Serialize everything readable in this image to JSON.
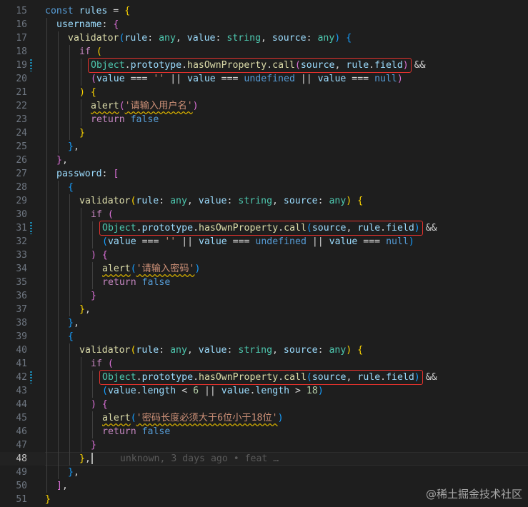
{
  "editor": {
    "active_line": 48,
    "lines": [
      {
        "n": 15,
        "indent": 0,
        "tokens": [
          [
            "kw",
            "const"
          ],
          [
            "t",
            " "
          ],
          [
            "prop",
            "rules"
          ],
          [
            "op",
            " = "
          ],
          [
            "p1",
            "{"
          ]
        ]
      },
      {
        "n": 16,
        "indent": 1,
        "tokens": [
          [
            "prop",
            "username"
          ],
          [
            "op",
            ": "
          ],
          [
            "p2",
            "{"
          ]
        ]
      },
      {
        "n": 17,
        "indent": 2,
        "tokens": [
          [
            "fn",
            "validator"
          ],
          [
            "p3",
            "("
          ],
          [
            "prop",
            "rule"
          ],
          [
            "op",
            ": "
          ],
          [
            "ty",
            "any"
          ],
          [
            "op",
            ", "
          ],
          [
            "prop",
            "value"
          ],
          [
            "op",
            ": "
          ],
          [
            "ty",
            "string"
          ],
          [
            "op",
            ", "
          ],
          [
            "prop",
            "source"
          ],
          [
            "op",
            ": "
          ],
          [
            "ty",
            "any"
          ],
          [
            "p3",
            ")"
          ],
          [
            "t",
            " "
          ],
          [
            "p3",
            "{"
          ]
        ]
      },
      {
        "n": 18,
        "indent": 3,
        "tokens": [
          [
            "ctrl",
            "if"
          ],
          [
            "t",
            " "
          ],
          [
            "p1",
            "("
          ]
        ]
      },
      {
        "n": 19,
        "indent": 4,
        "marker": true,
        "box": true,
        "tokens": [
          [
            "cls",
            "Object"
          ],
          [
            "op",
            "."
          ],
          [
            "prop",
            "prototype"
          ],
          [
            "op",
            "."
          ],
          [
            "fn",
            "hasOwnProperty"
          ],
          [
            "op",
            "."
          ],
          [
            "fn",
            "call"
          ],
          [
            "p2",
            "("
          ],
          [
            "prop",
            "source"
          ],
          [
            "op",
            ", "
          ],
          [
            "prop",
            "rule"
          ],
          [
            "op",
            "."
          ],
          [
            "prop",
            "field"
          ],
          [
            "p2",
            ")"
          ],
          [
            "op",
            " &&"
          ]
        ]
      },
      {
        "n": 20,
        "indent": 4,
        "tokens": [
          [
            "p2",
            "("
          ],
          [
            "prop",
            "value"
          ],
          [
            "op",
            " === "
          ],
          [
            "str",
            "''"
          ],
          [
            "op",
            " || "
          ],
          [
            "prop",
            "value"
          ],
          [
            "op",
            " === "
          ],
          [
            "kw",
            "undefined"
          ],
          [
            "op",
            " || "
          ],
          [
            "prop",
            "value"
          ],
          [
            "op",
            " === "
          ],
          [
            "kw",
            "null"
          ],
          [
            "p2",
            ")"
          ]
        ]
      },
      {
        "n": 21,
        "indent": 3,
        "tokens": [
          [
            "p1",
            ")"
          ],
          [
            "t",
            " "
          ],
          [
            "p1",
            "{"
          ]
        ]
      },
      {
        "n": 22,
        "indent": 4,
        "tokens": [
          [
            "fn warn",
            "alert"
          ],
          [
            "p2",
            "("
          ],
          [
            "str warn",
            "'请输入用户名'"
          ],
          [
            "p2",
            ")"
          ]
        ]
      },
      {
        "n": 23,
        "indent": 4,
        "tokens": [
          [
            "ctrl",
            "return"
          ],
          [
            "t",
            " "
          ],
          [
            "kw",
            "false"
          ]
        ]
      },
      {
        "n": 24,
        "indent": 3,
        "tokens": [
          [
            "p1",
            "}"
          ]
        ]
      },
      {
        "n": 25,
        "indent": 2,
        "tokens": [
          [
            "p3",
            "}"
          ],
          [
            "op",
            ","
          ]
        ]
      },
      {
        "n": 26,
        "indent": 1,
        "tokens": [
          [
            "p2",
            "}"
          ],
          [
            "op",
            ","
          ]
        ]
      },
      {
        "n": 27,
        "indent": 1,
        "tokens": [
          [
            "prop",
            "password"
          ],
          [
            "op",
            ": "
          ],
          [
            "p2",
            "["
          ]
        ]
      },
      {
        "n": 28,
        "indent": 2,
        "tokens": [
          [
            "p3",
            "{"
          ]
        ]
      },
      {
        "n": 29,
        "indent": 3,
        "tokens": [
          [
            "fn",
            "validator"
          ],
          [
            "p1",
            "("
          ],
          [
            "prop",
            "rule"
          ],
          [
            "op",
            ": "
          ],
          [
            "ty",
            "any"
          ],
          [
            "op",
            ", "
          ],
          [
            "prop",
            "value"
          ],
          [
            "op",
            ": "
          ],
          [
            "ty",
            "string"
          ],
          [
            "op",
            ", "
          ],
          [
            "prop",
            "source"
          ],
          [
            "op",
            ": "
          ],
          [
            "ty",
            "any"
          ],
          [
            "p1",
            ")"
          ],
          [
            "t",
            " "
          ],
          [
            "p1",
            "{"
          ]
        ]
      },
      {
        "n": 30,
        "indent": 4,
        "tokens": [
          [
            "ctrl",
            "if"
          ],
          [
            "t",
            " "
          ],
          [
            "p2",
            "("
          ]
        ]
      },
      {
        "n": 31,
        "indent": 5,
        "marker": true,
        "box": true,
        "tokens": [
          [
            "cls",
            "Object"
          ],
          [
            "op",
            "."
          ],
          [
            "prop",
            "prototype"
          ],
          [
            "op",
            "."
          ],
          [
            "fn",
            "hasOwnProperty"
          ],
          [
            "op",
            "."
          ],
          [
            "fn",
            "call"
          ],
          [
            "p3",
            "("
          ],
          [
            "prop",
            "source"
          ],
          [
            "op",
            ", "
          ],
          [
            "prop",
            "rule"
          ],
          [
            "op",
            "."
          ],
          [
            "prop",
            "field"
          ],
          [
            "p3",
            ")"
          ],
          [
            "op",
            " &&"
          ]
        ]
      },
      {
        "n": 32,
        "indent": 5,
        "tokens": [
          [
            "p3",
            "("
          ],
          [
            "prop",
            "value"
          ],
          [
            "op",
            " === "
          ],
          [
            "str",
            "''"
          ],
          [
            "op",
            " || "
          ],
          [
            "prop",
            "value"
          ],
          [
            "op",
            " === "
          ],
          [
            "kw",
            "undefined"
          ],
          [
            "op",
            " || "
          ],
          [
            "prop",
            "value"
          ],
          [
            "op",
            " === "
          ],
          [
            "kw",
            "null"
          ],
          [
            "p3",
            ")"
          ]
        ]
      },
      {
        "n": 33,
        "indent": 4,
        "tokens": [
          [
            "p2",
            ")"
          ],
          [
            "t",
            " "
          ],
          [
            "p2",
            "{"
          ]
        ]
      },
      {
        "n": 34,
        "indent": 5,
        "tokens": [
          [
            "fn warn",
            "alert"
          ],
          [
            "p3",
            "("
          ],
          [
            "str warn",
            "'请输入密码'"
          ],
          [
            "p3",
            ")"
          ]
        ]
      },
      {
        "n": 35,
        "indent": 5,
        "tokens": [
          [
            "ctrl",
            "return"
          ],
          [
            "t",
            " "
          ],
          [
            "kw",
            "false"
          ]
        ]
      },
      {
        "n": 36,
        "indent": 4,
        "tokens": [
          [
            "p2",
            "}"
          ]
        ]
      },
      {
        "n": 37,
        "indent": 3,
        "tokens": [
          [
            "p1",
            "}"
          ],
          [
            "op",
            ","
          ]
        ]
      },
      {
        "n": 38,
        "indent": 2,
        "tokens": [
          [
            "p3",
            "}"
          ],
          [
            "op",
            ","
          ]
        ]
      },
      {
        "n": 39,
        "indent": 2,
        "tokens": [
          [
            "p3",
            "{"
          ]
        ]
      },
      {
        "n": 40,
        "indent": 3,
        "tokens": [
          [
            "fn",
            "validator"
          ],
          [
            "p1",
            "("
          ],
          [
            "prop",
            "rule"
          ],
          [
            "op",
            ": "
          ],
          [
            "ty",
            "any"
          ],
          [
            "op",
            ", "
          ],
          [
            "prop",
            "value"
          ],
          [
            "op",
            ": "
          ],
          [
            "ty",
            "string"
          ],
          [
            "op",
            ", "
          ],
          [
            "prop",
            "source"
          ],
          [
            "op",
            ": "
          ],
          [
            "ty",
            "any"
          ],
          [
            "p1",
            ")"
          ],
          [
            "t",
            " "
          ],
          [
            "p1",
            "{"
          ]
        ]
      },
      {
        "n": 41,
        "indent": 4,
        "tokens": [
          [
            "ctrl",
            "if"
          ],
          [
            "t",
            " "
          ],
          [
            "p2",
            "("
          ]
        ]
      },
      {
        "n": 42,
        "indent": 5,
        "marker": true,
        "box": true,
        "tokens": [
          [
            "cls",
            "Object"
          ],
          [
            "op",
            "."
          ],
          [
            "prop",
            "prototype"
          ],
          [
            "op",
            "."
          ],
          [
            "fn",
            "hasOwnProperty"
          ],
          [
            "op",
            "."
          ],
          [
            "fn",
            "call"
          ],
          [
            "p3",
            "("
          ],
          [
            "prop",
            "source"
          ],
          [
            "op",
            ", "
          ],
          [
            "prop",
            "rule"
          ],
          [
            "op",
            "."
          ],
          [
            "prop",
            "field"
          ],
          [
            "p3",
            ")"
          ],
          [
            "op",
            " &&"
          ]
        ]
      },
      {
        "n": 43,
        "indent": 5,
        "tokens": [
          [
            "p3",
            "("
          ],
          [
            "prop",
            "value"
          ],
          [
            "op",
            "."
          ],
          [
            "prop",
            "length"
          ],
          [
            "op",
            " < "
          ],
          [
            "num",
            "6"
          ],
          [
            "op",
            " || "
          ],
          [
            "prop",
            "value"
          ],
          [
            "op",
            "."
          ],
          [
            "prop",
            "length"
          ],
          [
            "op",
            " > "
          ],
          [
            "num",
            "18"
          ],
          [
            "p3",
            ")"
          ]
        ]
      },
      {
        "n": 44,
        "indent": 4,
        "tokens": [
          [
            "p2",
            ")"
          ],
          [
            "t",
            " "
          ],
          [
            "p2",
            "{"
          ]
        ]
      },
      {
        "n": 45,
        "indent": 5,
        "tokens": [
          [
            "fn warn",
            "alert"
          ],
          [
            "p3",
            "("
          ],
          [
            "str warn",
            "'密码长度必须大于6位小于18位'"
          ],
          [
            "p3",
            ")"
          ]
        ]
      },
      {
        "n": 46,
        "indent": 5,
        "tokens": [
          [
            "ctrl",
            "return"
          ],
          [
            "t",
            " "
          ],
          [
            "kw",
            "false"
          ]
        ]
      },
      {
        "n": 47,
        "indent": 4,
        "tokens": [
          [
            "p2",
            "}"
          ]
        ]
      },
      {
        "n": 48,
        "indent": 3,
        "cursor": true,
        "blame": "unknown, 3 days ago • feat …",
        "tokens": [
          [
            "p1",
            "}"
          ],
          [
            "op",
            ","
          ]
        ]
      },
      {
        "n": 49,
        "indent": 2,
        "tokens": [
          [
            "p3",
            "}"
          ],
          [
            "op",
            ","
          ]
        ]
      },
      {
        "n": 50,
        "indent": 1,
        "tokens": [
          [
            "p2",
            "]"
          ],
          [
            "op",
            ","
          ]
        ]
      },
      {
        "n": 51,
        "indent": 0,
        "tokens": [
          [
            "p1",
            "}"
          ]
        ]
      }
    ]
  },
  "watermark": "@稀土掘金技术社区"
}
